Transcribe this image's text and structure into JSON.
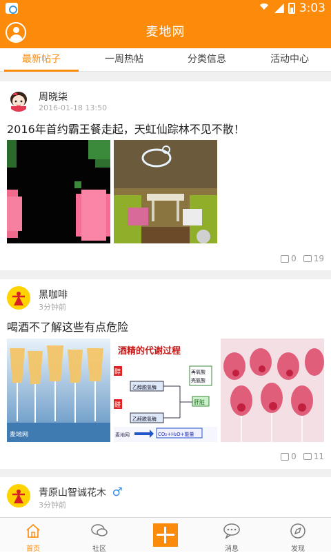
{
  "status_bar": {
    "time": "3:03",
    "icons": [
      "notification-icon",
      "wifi-icon",
      "signal-icon",
      "battery-icon"
    ]
  },
  "header": {
    "title": "麦地网"
  },
  "tabs": [
    {
      "label": "最新帖子",
      "active": true
    },
    {
      "label": "一周热帖",
      "active": false
    },
    {
      "label": "分类信息",
      "active": false
    },
    {
      "label": "活动中心",
      "active": false
    }
  ],
  "posts": [
    {
      "user": "周晓柒",
      "time": "2016-01-18 13:50",
      "title": "2016年首约霸王餐走起，天虹仙踪林不见不散！",
      "likes": "0",
      "comments": "19"
    },
    {
      "user": "黑咖啡",
      "time": "3分钟前",
      "title": "喝酒不了解这些有点危险",
      "likes": "0",
      "comments": "11"
    },
    {
      "user": "青原山智诚花木",
      "user_gender": "♂",
      "time": "3分钟前"
    }
  ],
  "image_texts": {
    "metabolism_title": "酒精的代谢过程",
    "box_1": "乙醇脱氢酶",
    "box_2": "乙醛脱氢酶",
    "box_3a": "再氧酸",
    "box_3b": "壳氨酸",
    "box_4": "肝脏",
    "box_5": "CO₂+H₂O+能量",
    "tag_1": "醇",
    "tag_2": "醛",
    "watermark": "麦地网"
  },
  "bottom_nav": [
    {
      "label": "首页",
      "icon": "home-icon",
      "active": true
    },
    {
      "label": "社区",
      "icon": "community-icon",
      "active": false
    },
    {
      "label": "",
      "icon": "add-icon",
      "active": false
    },
    {
      "label": "消息",
      "icon": "message-icon",
      "active": false
    },
    {
      "label": "发现",
      "icon": "discover-icon",
      "active": false
    }
  ],
  "colors": {
    "accent": "#fd8b0b",
    "background": "#f0f0f0"
  }
}
